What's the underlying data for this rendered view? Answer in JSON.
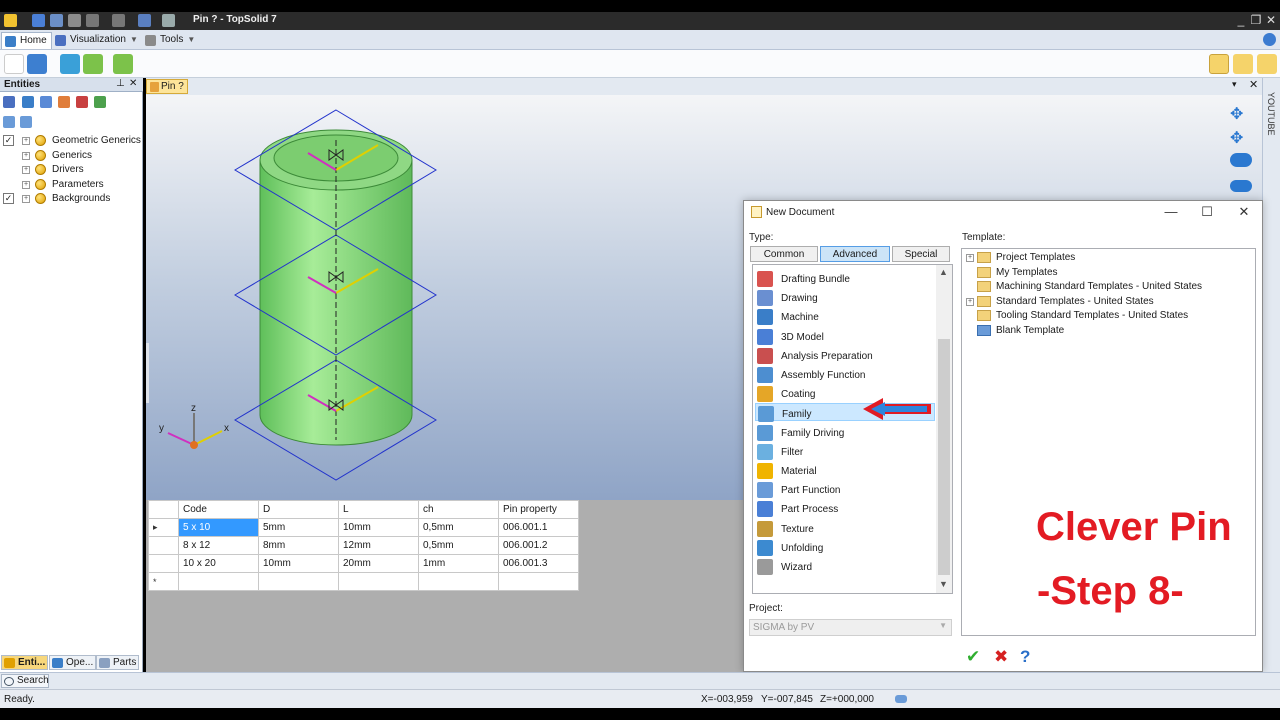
{
  "window": {
    "title": "Pin ? - TopSolid 7",
    "controls": [
      "_",
      "❐",
      "✕"
    ]
  },
  "ribbon": {
    "tabs": [
      {
        "label": "Home",
        "icon": "home-icon"
      },
      {
        "label": "Visualization",
        "icon": "visualization-icon"
      },
      {
        "label": "Tools",
        "icon": "tools-icon"
      }
    ]
  },
  "entities_panel": {
    "title": "Entities",
    "tree": [
      {
        "label": "Geometric Generics",
        "checked": true
      },
      {
        "label": "Generics",
        "checked": false
      },
      {
        "label": "Drivers",
        "checked": false
      },
      {
        "label": "Parameters",
        "checked": false
      },
      {
        "label": "Backgrounds",
        "checked": true
      }
    ],
    "bottom_tabs": [
      "Enti...",
      "Ope...",
      "Parts"
    ]
  },
  "document": {
    "tab_label": "Pin ?"
  },
  "axes": {
    "x": "x",
    "y": "y",
    "z": "z"
  },
  "family_table": {
    "columns": [
      "Code",
      "D",
      "L",
      "ch",
      "Pin property"
    ],
    "rows": [
      {
        "marker": "▸",
        "cells": [
          "5 x 10",
          "5mm",
          "10mm",
          "0,5mm",
          "006.001.1"
        ]
      },
      {
        "marker": "",
        "cells": [
          "8 x 12",
          "8mm",
          "12mm",
          "0,5mm",
          "006.001.2"
        ]
      },
      {
        "marker": "",
        "cells": [
          "10 x 20",
          "10mm",
          "20mm",
          "1mm",
          "006.001.3"
        ]
      },
      {
        "marker": "*",
        "cells": [
          "",
          "",
          "",
          "",
          ""
        ]
      }
    ]
  },
  "right_strip": {
    "label": "YOUTUBE"
  },
  "dialog": {
    "title": "New Document",
    "type_label": "Type:",
    "template_label": "Template:",
    "type_tabs": [
      "Common",
      "Advanced",
      "Special"
    ],
    "active_type_tab": "Advanced",
    "types": [
      {
        "label": "Drafting Bundle",
        "color": "#d9534f"
      },
      {
        "label": "Drawing",
        "color": "#6a8fd1"
      },
      {
        "label": "Machine",
        "color": "#3a7ec8"
      },
      {
        "label": "3D Model",
        "color": "#4a7fd6"
      },
      {
        "label": "Analysis Preparation",
        "color": "#c94f4f"
      },
      {
        "label": "Assembly Function",
        "color": "#4d8ed0"
      },
      {
        "label": "Coating",
        "color": "#e5a627"
      },
      {
        "label": "Family",
        "color": "#5a9ad6"
      },
      {
        "label": "Family Driving",
        "color": "#5a9ad6"
      },
      {
        "label": "Filter",
        "color": "#6bb0e0"
      },
      {
        "label": "Material",
        "color": "#f0b400"
      },
      {
        "label": "Part Function",
        "color": "#6a9bd8"
      },
      {
        "label": "Part Process",
        "color": "#4a7fd6"
      },
      {
        "label": "Texture",
        "color": "#c59a3a"
      },
      {
        "label": "Unfolding",
        "color": "#3c8ad0"
      },
      {
        "label": "Wizard",
        "color": "#9a9a9a"
      }
    ],
    "selected_type": "Family",
    "templates": [
      {
        "label": "Project Templates",
        "expandable": true
      },
      {
        "label": "My Templates",
        "expandable": false
      },
      {
        "label": "Machining Standard Templates - United States",
        "expandable": false
      },
      {
        "label": "Standard Templates - United States",
        "expandable": true
      },
      {
        "label": "Tooling Standard Templates - United States",
        "expandable": false
      },
      {
        "label": "Blank Template",
        "expandable": false
      }
    ],
    "project_label": "Project:",
    "project_value": "SIGMA by PV",
    "actions": {
      "ok": "✔",
      "cancel": "✖",
      "help": "?"
    }
  },
  "overlay": {
    "line1": "Clever Pin",
    "line2": "-Step 8-"
  },
  "search": {
    "label": "Search"
  },
  "status": {
    "text": "Ready.",
    "x": "X=-003,959",
    "y": "Y=-007,845",
    "z": "Z=+000,000"
  }
}
